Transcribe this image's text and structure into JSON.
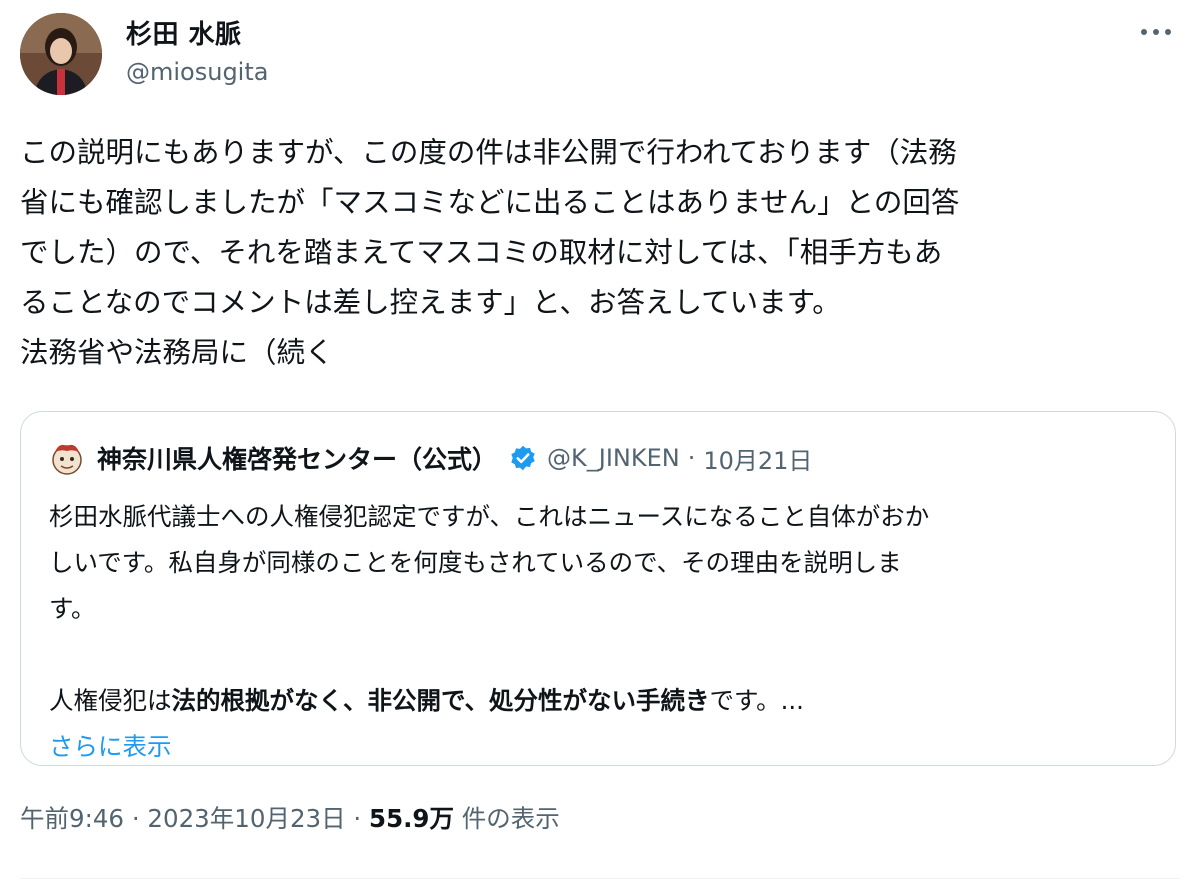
{
  "author": {
    "name": "杉田 水脈",
    "handle": "@miosugita",
    "avatar_icon": "user-avatar"
  },
  "tweet": {
    "lines": [
      "この説明にもありますが、この度の件は非公開で行われております（法務",
      "省にも確認しましたが「マスコミなどに出ることはありません」との回答",
      "でした）ので、それを踏まえてマスコミの取材に対しては、「相手方もあ",
      "ることなのでコメントは差し控えます」と、お答えしています。",
      "法務省や法務局に（続く"
    ]
  },
  "quote": {
    "name": "神奈川県人権啓発センター（公式）",
    "handle": "@K_JINKEN",
    "separator": "·",
    "date": "10月21日",
    "lines": [
      "杉田水脈代議士への人権侵犯認定ですが、これはニュースになること自体がおか",
      "しいです。私自身が同様のことを何度もされているので、その理由を説明しま",
      "す。"
    ],
    "last_line": {
      "prefix": "人権侵犯は",
      "bold": "法的根拠がなく、非公開で、処分性がない手続き",
      "suffix": "です。..."
    },
    "show_more": "さらに表示",
    "verified_color": "#1d9bf0"
  },
  "meta": {
    "time": "午前9:46",
    "separator1": "·",
    "date": "2023年10月23日",
    "separator2": "·",
    "views": "55.9万",
    "views_label": "件の表示"
  },
  "colors": {
    "text": "#0f1419",
    "secondary": "#536471",
    "link": "#1d9bf0",
    "border": "#cfd9de"
  }
}
